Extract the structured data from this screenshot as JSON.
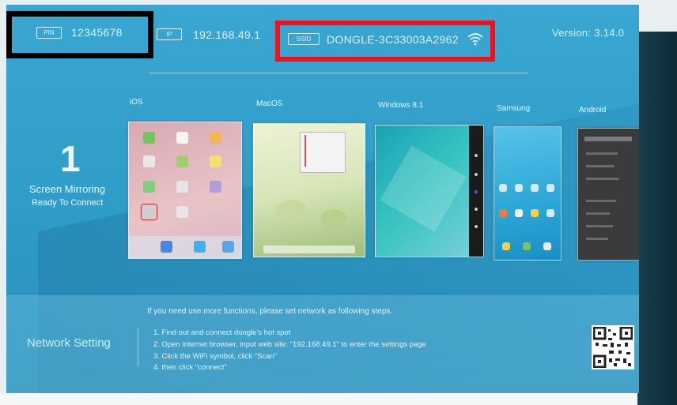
{
  "top_bar": {
    "pin_chip": "PIN",
    "pin_value": "12345678",
    "ip_chip": "IP",
    "ip_value": "192.168.49.1",
    "ssid_chip": "SSID",
    "ssid_value": "DONGLE-3C33003A2962",
    "version_text": "Version:  3.14.0"
  },
  "mirroring": {
    "number": "1",
    "title": "Screen Mirroring",
    "subtitle": "Ready To Connect"
  },
  "platforms": [
    {
      "label": "iOS"
    },
    {
      "label": "MacOS"
    },
    {
      "label": "Windows 8.1"
    },
    {
      "label": "Samsung"
    },
    {
      "label": "Android"
    }
  ],
  "network": {
    "title": "Network Setting",
    "intro": "If you need use more functions, please set network as following steps.",
    "steps": [
      "1. Find out and connect dongle's hot spot",
      "2. Open internet browser, input web site: \"192.168.49.1\" to enter the settings page",
      "3. Click the WiFi symbol, click \"Scan\"",
      "4.  then click \"connect\""
    ]
  },
  "colors": {
    "screen_bg": "#2f9bc7",
    "highlight_pin": "#000000",
    "highlight_ssid": "#f2101a"
  },
  "icons": [
    "wifi-icon",
    "qr-code"
  ]
}
